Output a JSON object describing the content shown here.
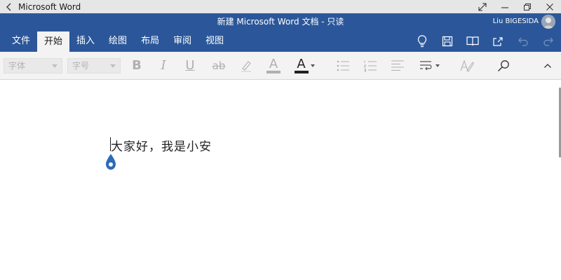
{
  "window": {
    "app_title": "Microsoft Word",
    "back_icon": "back-arrow-icon",
    "controls": [
      "expand-icon",
      "minimize-icon",
      "restore-icon",
      "close-icon"
    ]
  },
  "header": {
    "doc_title": "新建 Microsoft Word 文档 - 只读",
    "user_name": "Liu BIGESIDA"
  },
  "tabs": [
    {
      "label": "文件",
      "active": false
    },
    {
      "label": "开始",
      "active": true
    },
    {
      "label": "插入",
      "active": false
    },
    {
      "label": "绘图",
      "active": false
    },
    {
      "label": "布局",
      "active": false
    },
    {
      "label": "审阅",
      "active": false
    },
    {
      "label": "视图",
      "active": false
    }
  ],
  "tab_icons": [
    "lightbulb-icon",
    "save-icon",
    "reading-view-icon",
    "share-icon",
    "undo-icon",
    "redo-icon"
  ],
  "ribbon": {
    "font_name_placeholder": "字体",
    "font_size_placeholder": "字号",
    "bold_glyph": "B",
    "italic_glyph": "I",
    "underline_glyph": "U",
    "strike_glyph": "ab",
    "font_color_glyph": "A",
    "font_color_bar": "#b0b0b0",
    "text_color_glyph": "A",
    "text_color_bar": "#222222"
  },
  "document": {
    "text": "大家好，我是小安"
  },
  "colors": {
    "brand": "#2b579a",
    "ribbon_bg": "#f3f3f3",
    "handle": "#2b6cb8"
  }
}
